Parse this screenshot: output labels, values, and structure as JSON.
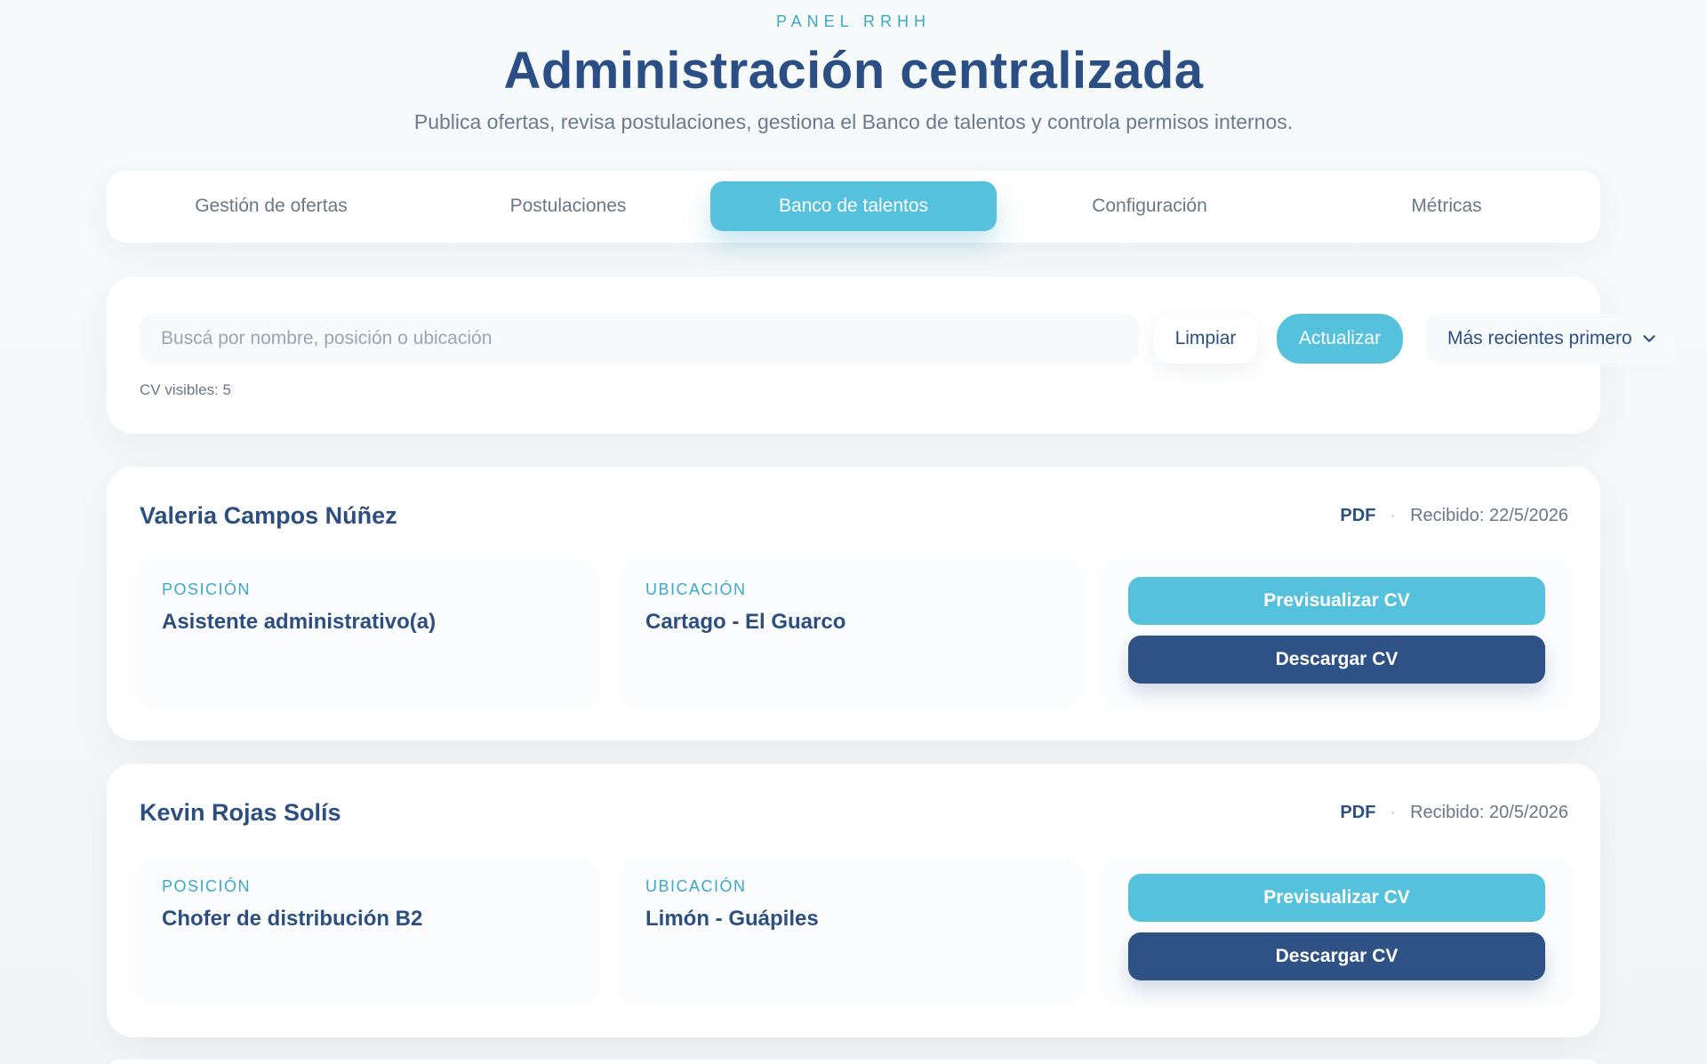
{
  "header": {
    "eyebrow": "PANEL RRHH",
    "title": "Administración centralizada",
    "subtitle": "Publica ofertas, revisa postulaciones, gestiona el Banco de talentos y controla permisos internos."
  },
  "tabs": [
    {
      "label": "Gestión de ofertas",
      "active": false
    },
    {
      "label": "Postulaciones",
      "active": false
    },
    {
      "label": "Banco de talentos",
      "active": true
    },
    {
      "label": "Configuración",
      "active": false
    },
    {
      "label": "Métricas",
      "active": false
    }
  ],
  "search": {
    "placeholder": "Buscá por nombre, posición o ubicación",
    "value": "",
    "clear_label": "Limpiar",
    "refresh_label": "Actualizar",
    "sort_selected": "Más recientes primero",
    "count_text": "CV visibles: 5"
  },
  "candidates": [
    {
      "name": "Valeria Campos Núñez",
      "format": "PDF",
      "separator": "·",
      "received": "Recibido: 22/5/2026",
      "position_label": "POSICIÓN",
      "position": "Asistente administrativo(a)",
      "location_label": "UBICACIÓN",
      "location": "Cartago - El Guarco",
      "preview_label": "Previsualizar CV",
      "download_label": "Descargar CV"
    },
    {
      "name": "Kevin Rojas Solís",
      "format": "PDF",
      "separator": "·",
      "received": "Recibido: 20/5/2026",
      "position_label": "POSICIÓN",
      "position": "Chofer de distribución B2",
      "location_label": "UBICACIÓN",
      "location": "Limón - Guápiles",
      "preview_label": "Previsualizar CV",
      "download_label": "Descargar CV"
    }
  ],
  "icons": {
    "sort": "chevron-down-icon"
  },
  "colors": {
    "accent": "#56c1dc",
    "primary_dark": "#2e5285",
    "label_teal": "#3aa8c9",
    "text": "#2c4f80",
    "muted": "#6b7686"
  }
}
